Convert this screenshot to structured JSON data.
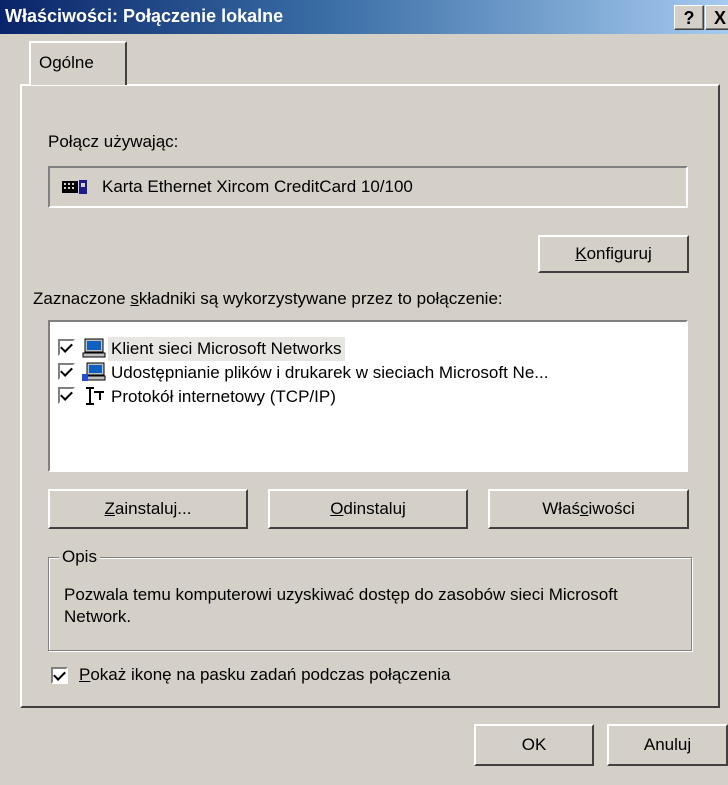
{
  "window": {
    "title": "Właściwości: Połączenie lokalne",
    "help_label": "?",
    "close_label": "X"
  },
  "tabs": [
    {
      "label": "Ogólne"
    }
  ],
  "connect": {
    "label": "Połącz używając:",
    "adapter_name": "Karta Ethernet Xircom CreditCard 10/100",
    "adapter_icon": "network-card-icon",
    "configure_prefix": "",
    "configure_accel": "K",
    "configure_rest": "onfiguruj"
  },
  "components": {
    "label_pre": "Zaznaczone ",
    "label_accel": "s",
    "label_post": "kładniki są wykorzystywane przez to połączenie:",
    "items": [
      {
        "label": "Klient sieci Microsoft Networks",
        "checked": true,
        "icon": "computer-icon"
      },
      {
        "label": "Udostępnianie plików i drukarek w sieciach Microsoft Ne...",
        "checked": true,
        "icon": "shared-computer-icon"
      },
      {
        "label": "Protokół internetowy (TCP/IP)",
        "checked": true,
        "icon": "network-protocol-icon"
      }
    ]
  },
  "buttons": {
    "install_accel": "Z",
    "install_rest": "ainstaluj...",
    "uninstall_accel": "O",
    "uninstall_rest": "dinstaluj",
    "props_pre": "Właś",
    "props_accel": "c",
    "props_rest": "iwości"
  },
  "description": {
    "label": "Opis",
    "text": "Pozwala temu komputerowi uzyskiwać dostęp do zasobów sieci Microsoft Network."
  },
  "show_icon": {
    "checked": true,
    "accel": "P",
    "rest": "okaż ikonę na pasku zadań podczas połączenia"
  },
  "footer": {
    "ok_label": "OK",
    "cancel_label": "Anuluj"
  }
}
